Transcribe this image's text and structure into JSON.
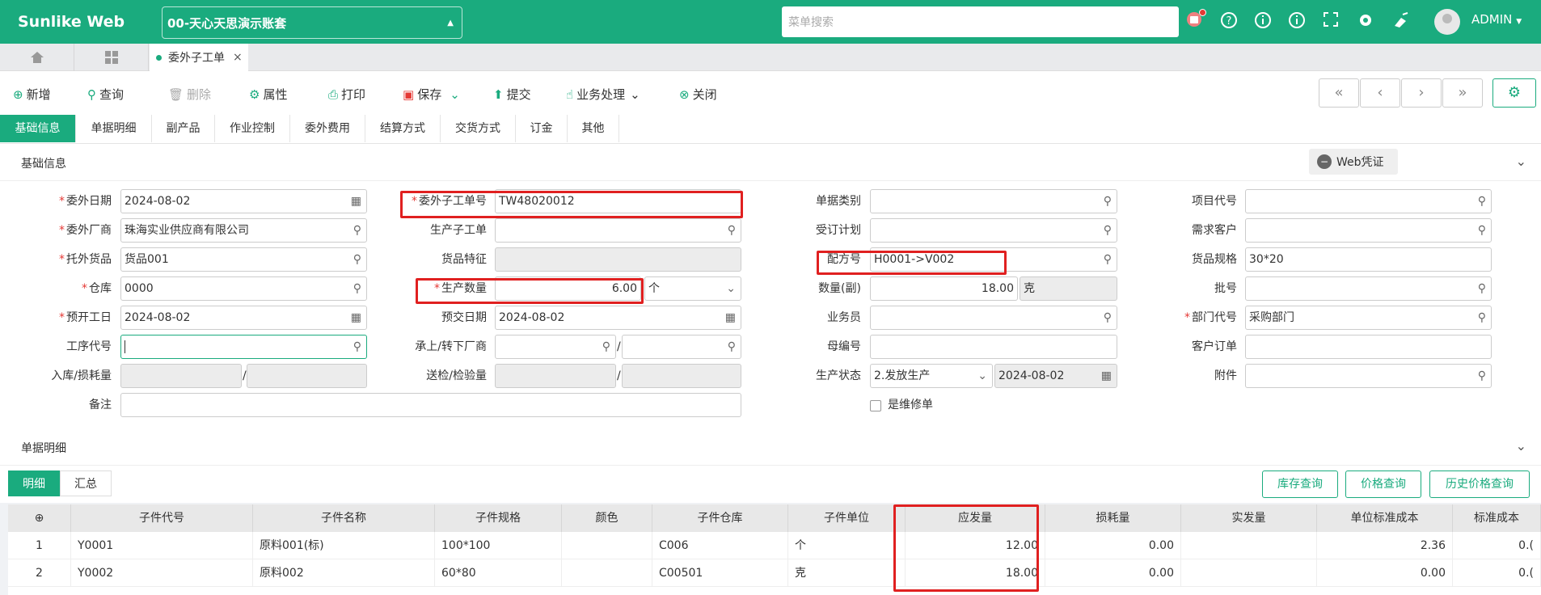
{
  "app": {
    "brand": "Sunlike Web",
    "account": "00-天心天思演示账套",
    "search_placeholder": "菜单搜索",
    "user": "ADMIN"
  },
  "tabs": {
    "doc": "委外子工单"
  },
  "toolbar": {
    "add": "新增",
    "query": "查询",
    "delete": "删除",
    "props": "属性",
    "print": "打印",
    "save": "保存",
    "submit": "提交",
    "biz": "业务处理",
    "close": "关闭"
  },
  "subtabs": [
    "基础信息",
    "单据明细",
    "副产品",
    "作业控制",
    "委外费用",
    "结算方式",
    "交货方式",
    "订金",
    "其他"
  ],
  "basic": {
    "title": "基础信息",
    "web_btn": "Web凭证"
  },
  "form": {
    "labels": {
      "wwrq": "委外日期",
      "wwzgdh": "委外子工单号",
      "djlb": "单据类别",
      "xmdh": "项目代号",
      "wwcs": "委外厂商",
      "sczgd": "生产子工单",
      "sdjh": "受订计划",
      "xqkh": "需求客户",
      "twhp": "托外货品",
      "hptz": "货品特征",
      "pfh": "配方号",
      "hpgg": "货品规格",
      "ck": "仓库",
      "scsl": "生产数量",
      "slf": "数量(副)",
      "ph": "批号",
      "kgr": "预开工日",
      "yjrq": "预交日期",
      "ywy": "业务员",
      "bmdh": "部门代号",
      "gxdh": "工序代号",
      "cs": "承上/转下厂商",
      "mbh": "母编号",
      "khdd": "客户订单",
      "rksh": "入库/损耗量",
      "sjjy": "送检/检验量",
      "sczt": "生产状态",
      "fj": "附件",
      "bz": "备注",
      "wxd": "是维修单"
    },
    "values": {
      "wwrq": "2024-08-02",
      "wwzgdh": "TW48020012",
      "wwcs": "珠海实业供应商有限公司",
      "twhp": "货品001",
      "pfh": "H0001->V002",
      "hpgg": "30*20",
      "ck": "0000",
      "scsl": "6.00",
      "scsl_unit": "个",
      "slf": "18.00",
      "slf_unit": "克",
      "kgr": "2024-08-02",
      "yjrq": "2024-08-02",
      "bmdh": "采购部门",
      "sczt": "2.发放生产",
      "sczt_date": "2024-08-02"
    }
  },
  "detail": {
    "title": "单据明细",
    "tab_detail": "明细",
    "tab_sum": "汇总",
    "btn_stock": "库存查询",
    "btn_price": "价格查询",
    "btn_hist": "历史价格查询",
    "columns": [
      "子件代号",
      "子件名称",
      "子件规格",
      "颜色",
      "子件仓库",
      "子件单位",
      "应发量",
      "损耗量",
      "实发量",
      "单位标准成本",
      "标准成本"
    ],
    "rows": [
      {
        "no": "1",
        "code": "Y0001",
        "name": "原料001(标)",
        "spec": "100*100",
        "color": "",
        "wh": "C006",
        "unit": "个",
        "yfl": "12.00",
        "shl": "0.00",
        "sfl": "",
        "dwcb": "2.36",
        "bzcb": "0.("
      },
      {
        "no": "2",
        "code": "Y0002",
        "name": "原料002",
        "spec": "60*80",
        "color": "",
        "wh": "C00501",
        "unit": "克",
        "yfl": "18.00",
        "shl": "0.00",
        "sfl": "",
        "dwcb": "0.00",
        "bzcb": "0.("
      }
    ]
  },
  "colors": {
    "primary": "#1aab7e",
    "highlight": "#e02020"
  }
}
